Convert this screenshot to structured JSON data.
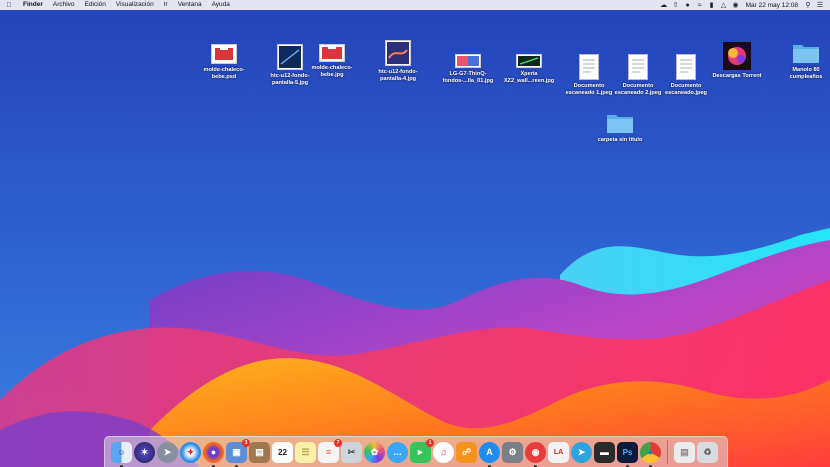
{
  "menubar": {
    "app_name": "Finder",
    "menus": [
      "Archivo",
      "Edición",
      "Visualización",
      "Ir",
      "Ventana",
      "Ayuda"
    ],
    "status_icons": [
      "cloud-icon",
      "upload-icon",
      "bell-icon",
      "wifi-icon",
      "battery-icon",
      "airplay-icon",
      "wifi-signal-icon"
    ],
    "clock": "Mar 22 may  12:08"
  },
  "desktop": {
    "icons": [
      {
        "label": "molde-chaleco-\nbebe.psd",
        "icon": "psd-file-icon",
        "color": "#d9363e"
      },
      {
        "label": "htc-u12-fondo-\npantalla-5.jpg",
        "icon": "image-file-icon",
        "color": "#1a3a6e"
      },
      {
        "label": "molde-chaleco-\nbebe.jpg",
        "icon": "image-file-icon",
        "color": "#d9363e"
      },
      {
        "label": "htc-u12-fondo-\npantalla-4.jpg",
        "icon": "image-file-icon",
        "color": "#2b2f7a"
      },
      {
        "label": "LG-G7-ThinQ-\nfondos-...lla_01.jpg",
        "icon": "image-file-icon",
        "color": "#e9566c"
      },
      {
        "label": "Xperia\nXZ2_wall...reen.jpg",
        "icon": "image-file-icon",
        "color": "#2f8a4a"
      },
      {
        "label": "Documento\nescaneado 1.jpeg",
        "icon": "document-icon",
        "color": "#ffffff"
      },
      {
        "label": "Documento\nescaneado 2.jpeg",
        "icon": "document-icon",
        "color": "#ffffff"
      },
      {
        "label": "Documento\nescaneado.jpeg",
        "icon": "document-icon",
        "color": "#ffffff"
      },
      {
        "label": "Descargas Torrent",
        "icon": "image-file-icon",
        "color": "#e53a7a"
      },
      {
        "label": "Manolo 80\ncumpleaños",
        "icon": "folder-icon",
        "color": "#6bb8ec"
      },
      {
        "label": "carpeta sin título",
        "icon": "folder-icon",
        "color": "#6bb8ec"
      }
    ]
  },
  "dock": {
    "items": [
      {
        "icon": "finder-icon",
        "color": "#3d8be8",
        "running": true
      },
      {
        "icon": "siri-icon",
        "color": "#1f1f3a",
        "running": false
      },
      {
        "icon": "launchpad-icon",
        "color": "#8a8fa0",
        "running": false
      },
      {
        "icon": "safari-icon",
        "color": "#2a8ce6",
        "running": false
      },
      {
        "icon": "firefox-icon",
        "color": "#f36b1f",
        "running": true
      },
      {
        "icon": "preview-icon",
        "color": "#5f8ed6",
        "badge": "3",
        "running": true
      },
      {
        "icon": "notefile-icon",
        "color": "#a07850",
        "running": false
      },
      {
        "icon": "calendar-icon",
        "color": "#ffffff",
        "text": "22",
        "running": false
      },
      {
        "icon": "notes-icon",
        "color": "#fbf0a8",
        "running": false
      },
      {
        "icon": "reminders-icon",
        "color": "#f4f4f4",
        "badge": "7",
        "running": false
      },
      {
        "icon": "scissors-icon",
        "color": "#cfd4dc",
        "running": false
      },
      {
        "icon": "photos-icon",
        "color": "#f6b93b",
        "running": false
      },
      {
        "icon": "messages-icon",
        "color": "#3aa6f5",
        "running": false
      },
      {
        "icon": "facetime-icon",
        "color": "#36c35a",
        "badge": "1",
        "running": false
      },
      {
        "icon": "itunes-icon",
        "color": "#f04e8a",
        "running": false
      },
      {
        "icon": "books-icon",
        "color": "#f6921e",
        "running": false
      },
      {
        "icon": "appstore-icon",
        "color": "#1f8cf0",
        "running": true
      },
      {
        "icon": "system-preferences-icon",
        "color": "#7a7f88",
        "running": false
      },
      {
        "icon": "vpn-icon",
        "color": "#e83c3c",
        "running": true
      },
      {
        "icon": "lightroom-icon",
        "color": "#f2f2f2",
        "text": "LA",
        "running": false
      },
      {
        "icon": "telegram-icon",
        "color": "#2fa3e0",
        "running": false
      },
      {
        "icon": "airport-icon",
        "color": "#2a2a2a",
        "running": false
      },
      {
        "icon": "photoshop-icon",
        "color": "#0d1b3a",
        "text": "Ps",
        "running": true
      },
      {
        "icon": "chrome-icon",
        "color": "#e8e8e8",
        "running": true
      },
      {
        "icon": "document-icon",
        "color": "#ececec",
        "running": false
      },
      {
        "icon": "trash-icon",
        "color": "#d8dbe0",
        "running": false
      }
    ]
  }
}
